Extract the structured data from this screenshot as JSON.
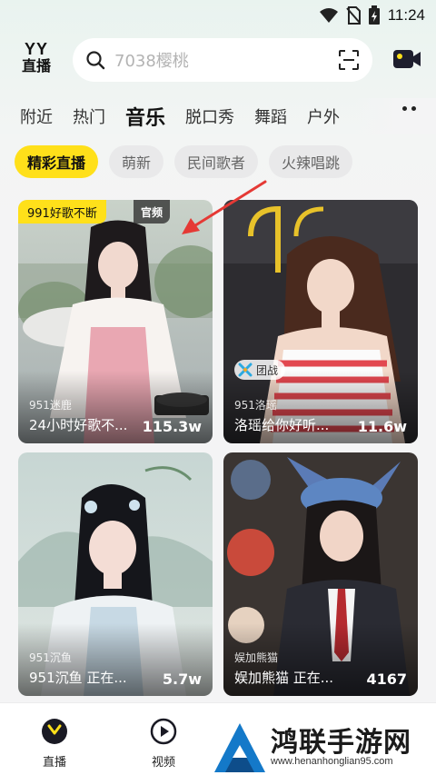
{
  "status_bar": {
    "time": "11:24"
  },
  "header": {
    "logo_top": "YY",
    "logo_bottom": "直播",
    "search_placeholder": "7038樱桃",
    "icons": [
      "search-icon",
      "scan-icon",
      "camera-icon"
    ]
  },
  "category_tabs": [
    "附近",
    "热门",
    "音乐",
    "脱口秀",
    "舞蹈",
    "户外"
  ],
  "active_category": "音乐",
  "chips": [
    "精彩直播",
    "萌新",
    "民间歌者",
    "火辣唱跳"
  ],
  "active_chip": "精彩直播",
  "cards": [
    {
      "tag": "991好歌不断",
      "official": "官频",
      "anchor": "951迷鹿",
      "title": "24小时好歌不...",
      "count": "115.3w"
    },
    {
      "battle": "团战",
      "anchor": "951洛瑶",
      "title": "洛瑶给你好听...",
      "count": "11.6w"
    },
    {
      "anchor": "951沉鱼",
      "title": "951沉鱼 正在...",
      "count": "5.7w"
    },
    {
      "anchor": "娱加熊猫",
      "title": "娱加熊猫 正在...",
      "count": "4167"
    }
  ],
  "bottom_nav": [
    {
      "label": "直播",
      "icon": "live-icon",
      "active": true
    },
    {
      "label": "视频",
      "icon": "video-play-icon",
      "active": false
    }
  ],
  "watermark": {
    "text": "鸿联手游网",
    "url": "www.henanhonglian95.com"
  },
  "colors": {
    "accent": "#ffe01a",
    "background": "#f4f4f5",
    "annotation": "#e53935"
  }
}
